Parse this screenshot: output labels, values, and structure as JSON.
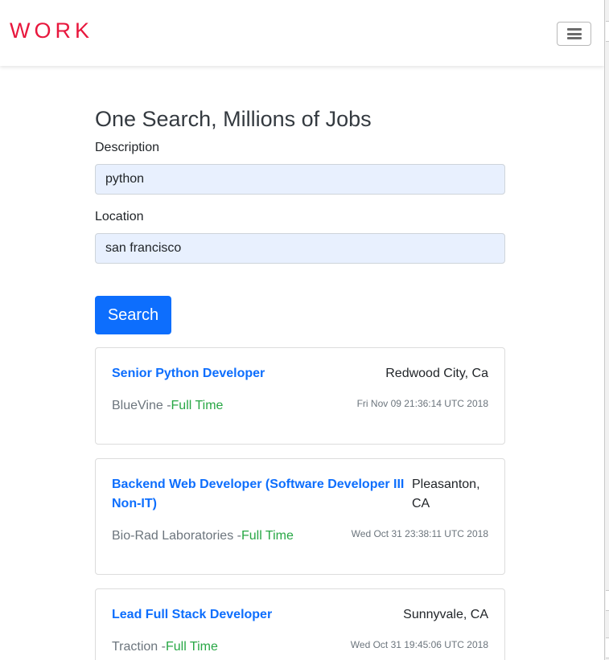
{
  "navbar": {
    "brand": "WORK",
    "toggler_icon": "hamburger-menu-icon"
  },
  "search": {
    "title": "One Search, Millions of Jobs",
    "description_label": "Description",
    "description_value": "python",
    "location_label": "Location",
    "location_value": "san francisco",
    "button_label": "Search"
  },
  "jobs": [
    {
      "title": "Senior Python Developer",
      "location": "Redwood City, Ca",
      "company": "BlueVine -",
      "type": "Full Time",
      "date": "Fri Nov 09 21:36:14 UTC 2018"
    },
    {
      "title": "Backend Web Developer (Software Developer III Non-IT)",
      "location": "Pleasanton, CA",
      "company": "Bio-Rad Laboratories -",
      "type": "Full Time",
      "date": "Wed Oct 31 23:38:11 UTC 2018"
    },
    {
      "title": "Lead Full Stack Developer",
      "location": "Sunnyvale, CA",
      "company": "Traction -",
      "type": "Full Time",
      "date": "Wed Oct 31 19:45:06 UTC 2018"
    }
  ],
  "colors": {
    "brand": "#e8173d",
    "accent": "#0d6efd",
    "job_type": "#28a745",
    "input_fill": "#e8f0fe"
  }
}
